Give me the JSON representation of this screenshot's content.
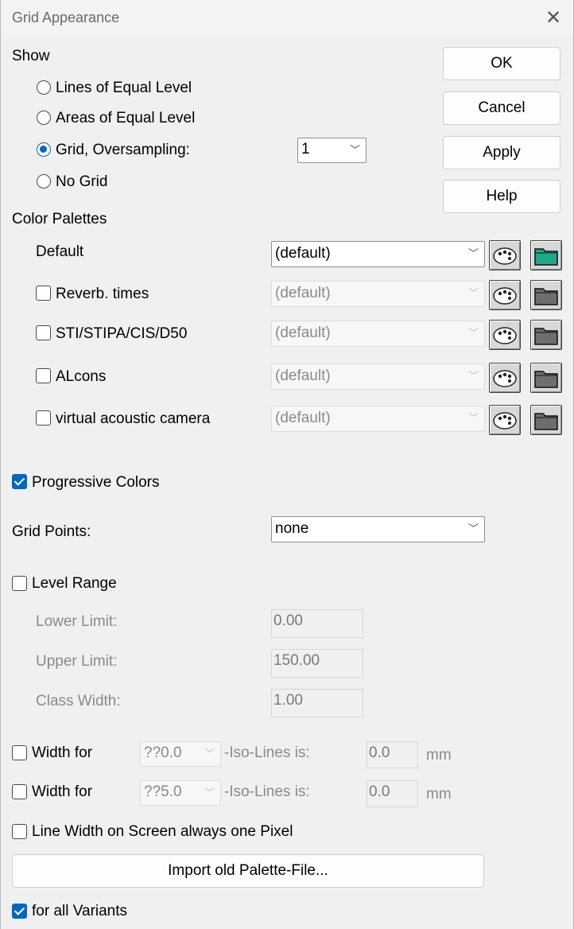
{
  "window": {
    "title": "Grid Appearance",
    "close_glyph": "✕"
  },
  "buttons": {
    "ok": "OK",
    "cancel": "Cancel",
    "apply": "Apply",
    "help": "Help"
  },
  "show": {
    "heading": "Show",
    "options": [
      {
        "label": "Lines of Equal Level",
        "selected": false
      },
      {
        "label": "Areas of Equal Level",
        "selected": false
      },
      {
        "label": "Grid, Oversampling:",
        "selected": true
      },
      {
        "label": "No Grid",
        "selected": false
      }
    ],
    "oversampling": {
      "value": "1"
    }
  },
  "palettes": {
    "heading": "Color Palettes",
    "default_label": "Default",
    "rows": [
      {
        "label": "Reverb. times",
        "checked": false,
        "value": "(default)"
      },
      {
        "label": "STI/STIPA/CIS/D50",
        "checked": false,
        "value": "(default)"
      },
      {
        "label": "ALcons",
        "checked": false,
        "value": "(default)"
      },
      {
        "label": "virtual acoustic camera",
        "checked": false,
        "value": "(default)"
      }
    ],
    "default_value": "(default)",
    "icons": {
      "palette": "palette-icon",
      "folder": "folder-icon"
    },
    "colors": {
      "folder_active": "#1fa88a",
      "folder_inactive": "#6e6e6e"
    }
  },
  "progressive": {
    "label": "Progressive Colors",
    "checked": true
  },
  "grid_points": {
    "label": "Grid Points:",
    "value": "none"
  },
  "level_range": {
    "label": "Level Range",
    "checked": false,
    "lower_label": "Lower Limit:",
    "lower_value": "0.00",
    "upper_label": "Upper Limit:",
    "upper_value": "150.00",
    "class_label": "Class Width:",
    "class_value": "1.00"
  },
  "width_rows": [
    {
      "label": "Width for",
      "checked": false,
      "combo": "??0.0",
      "mid": "-Iso-Lines is:",
      "value": "0.0",
      "unit": "mm"
    },
    {
      "label": "Width for",
      "checked": false,
      "combo": "??5.0",
      "mid": "-Iso-Lines is:",
      "value": "0.0",
      "unit": "mm"
    }
  ],
  "line_width": {
    "label": "Line Width on Screen always one Pixel",
    "checked": false
  },
  "import_button": "Import old Palette-File...",
  "all_variants": {
    "label": "for all Variants",
    "checked": true
  },
  "accent": "#0067c0"
}
